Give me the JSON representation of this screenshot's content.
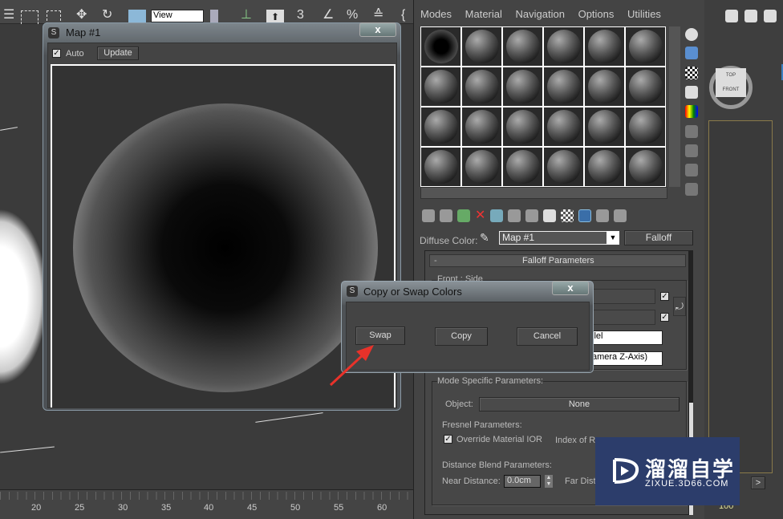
{
  "toolbar": {
    "view_dropdown": "View",
    "snap_value": "3",
    "percent_symbol": "%"
  },
  "timeline": {
    "ticks": [
      "20",
      "25",
      "30",
      "35",
      "40",
      "45",
      "50",
      "55",
      "60"
    ]
  },
  "map_window": {
    "title": "Map #1",
    "auto_label": "Auto",
    "auto_checked": true,
    "update_label": "Update",
    "close": "x"
  },
  "material_editor": {
    "menu": [
      "Modes",
      "Material",
      "Navigation",
      "Options",
      "Utilities"
    ],
    "diffuse_label": "Diffuse Color:",
    "map_name": "Map #1",
    "map_type": "Falloff",
    "rollout_title": "Falloff Parameters",
    "rollout_collapse": "-",
    "front_side_label": "Front : Side",
    "falloff_type_partial": "llel",
    "direction_partial": "amera Z-Axis)",
    "mode_specific_label": "Mode Specific Parameters:",
    "object_label": "Object:",
    "object_value": "None",
    "fresnel_label": "Fresnel Parameters:",
    "override_ior_label": "Override Material IOR",
    "override_ior_checked": true,
    "ior_label_partial": "Index of Re",
    "distance_blend_label": "Distance Blend Parameters:",
    "near_distance_label": "Near Distance:",
    "near_distance_value": "0.0cm",
    "far_distance_partial": "Far Dista"
  },
  "dialog": {
    "title": "Copy or Swap Colors",
    "close": "x",
    "buttons": [
      "Swap",
      "Copy",
      "Cancel"
    ]
  },
  "right_panel": {
    "viewcube_top": "TOP",
    "viewcube_front": "FRONT",
    "next": ">",
    "frame": "100"
  },
  "watermark": {
    "brand": "溜溜自学",
    "url": "ZIXUE.3D66.COM"
  },
  "colors": {
    "annotation_arrow": "#e8322a",
    "watermark_bg": "#2c3d6b",
    "active_button": "#3a6ea8"
  }
}
